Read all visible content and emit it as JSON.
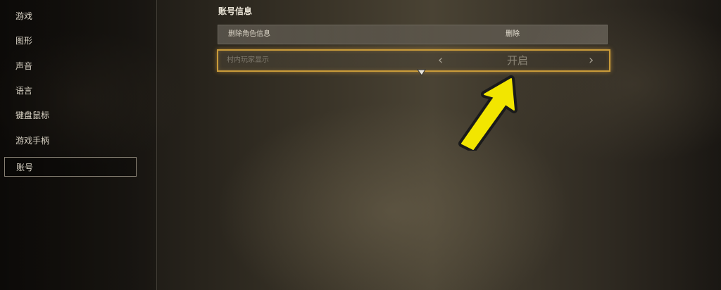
{
  "sidebar": {
    "items": [
      {
        "label": "游戏"
      },
      {
        "label": "图形"
      },
      {
        "label": "声音"
      },
      {
        "label": "语言"
      },
      {
        "label": "键盘鼠标"
      },
      {
        "label": "游戏手柄"
      },
      {
        "label": "账号",
        "active": true
      }
    ]
  },
  "main": {
    "section_title": "账号信息",
    "delete_row": {
      "label": "删除角色信息",
      "action_label": "删除"
    },
    "toggle_row": {
      "label": "村内玩家显示",
      "value": "开启",
      "prev_icon": "chevron-left-icon",
      "next_icon": "chevron-right-icon"
    }
  },
  "overlay": {
    "annotation_icon": "yellow-arrow-icon",
    "annotation_color": "#f2e600",
    "highlight_color": "#c99b3a"
  }
}
